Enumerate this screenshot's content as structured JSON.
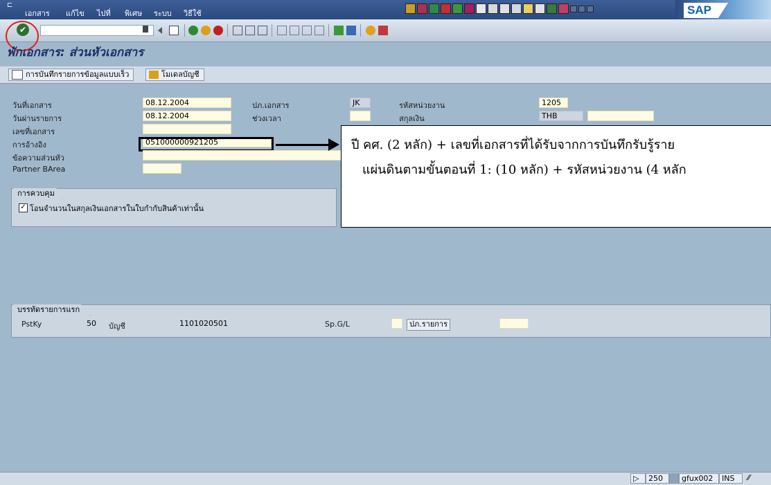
{
  "menu": {
    "items": [
      "เอกสาร",
      "แก้ไข",
      "ไปที่",
      "พิเศษ",
      "ระบบ",
      "วิธีใช้"
    ]
  },
  "branding": {
    "logo_text": "SAP"
  },
  "icons": {
    "enter": "check-circle-icon",
    "save": "save-icon",
    "back": "back-icon",
    "exit": "exit-icon",
    "cancel": "cancel-icon",
    "print": "print-icon",
    "find": "find-icon",
    "find_next": "find-next-icon",
    "help": "help-icon"
  },
  "colors": {
    "menu_bg": "#2b4a80",
    "title": "#1e2e66",
    "field_bg": "#fffbe3",
    "highlight_ring": "#e1221b"
  },
  "page": {
    "title": "พักเอกสาร: ส่วนหัวเอกสาร"
  },
  "app_toolbar": {
    "fast_entry_label": "การบันทึกรายการข้อมูลแบบเร็ว",
    "account_model_label": "โมเดลบัญชี"
  },
  "header": {
    "doc_date_label": "วันที่เอกสาร",
    "doc_date_value": "08.12.2004",
    "posting_date_label": "วันผ่านรายการ",
    "posting_date_value": "08.12.2004",
    "doc_number_label": "เลขที่เอกสาร",
    "doc_number_value": "",
    "reference_label": "การอ้างอิง",
    "reference_value": "051000000921205",
    "header_text_label": "ข้อความส่วนหัว",
    "header_text_value": "",
    "partner_barea_label": "Partner BArea",
    "partner_barea_value": "",
    "doc_type_label": "ปภ.เอกสาร",
    "doc_type_value": "JK",
    "period_label": "ช่วงเวลา",
    "period_value": "",
    "company_code_label": "รหัสหน่วยงาน",
    "company_code_value": "1205",
    "currency_label": "สกุลเงิน",
    "currency_value": "THB",
    "rate_value": ""
  },
  "control": {
    "tab_label": "การควบคุม",
    "checkbox_label": "โอนจำนวนในสกุลเงินเอกสารในใบกำกับสินค้าเท่านั้น",
    "checkbox_checked": true,
    "checkbox_mark": "✓"
  },
  "annotation": {
    "line1": "ปี คศ. (2 หลัก) + เลขที่เอกสารที่ได้รับจากการบันทึกรับรู้ราย",
    "line2": "แผ่นดินตามขั้นตอนที่ 1:  (10 หลัก) + รหัสหน่วยงาน (4 หลัก"
  },
  "first_line_item": {
    "tab_label": "บรรทัดรายการแรก",
    "pstky_label": "PstKy",
    "pstky_value": "50",
    "account_label": "บัญชี",
    "account_value": "1101020501",
    "spgl_label": "Sp.G/L",
    "spgl_value": "",
    "item_type_label": "ปภ.รายการ",
    "item_type_value": ""
  },
  "status_bar": {
    "client": "250",
    "server": "gfux002",
    "mode": "INS"
  }
}
